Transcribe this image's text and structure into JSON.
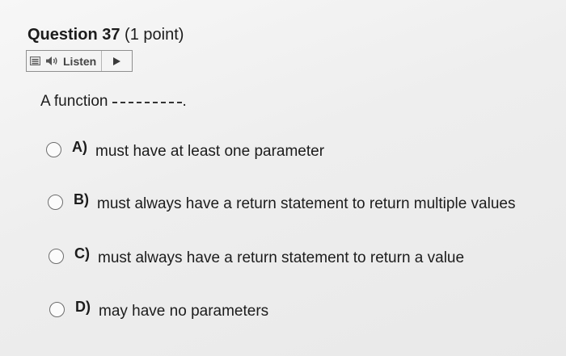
{
  "question": {
    "title": "Question 37",
    "points": "(1 point)"
  },
  "listen": {
    "label": "Listen",
    "menu_icon": "menu-icon",
    "speaker_icon": "speaker-icon",
    "play_icon": "play-icon"
  },
  "prompt": {
    "text": "A function",
    "end": "."
  },
  "options": [
    {
      "letter": "A)",
      "text": "must have at least one parameter"
    },
    {
      "letter": "B)",
      "text": "must always have a return statement to return multiple values"
    },
    {
      "letter": "C)",
      "text": "must always have a return statement to return a value"
    },
    {
      "letter": "D)",
      "text": "may have no parameters"
    }
  ]
}
